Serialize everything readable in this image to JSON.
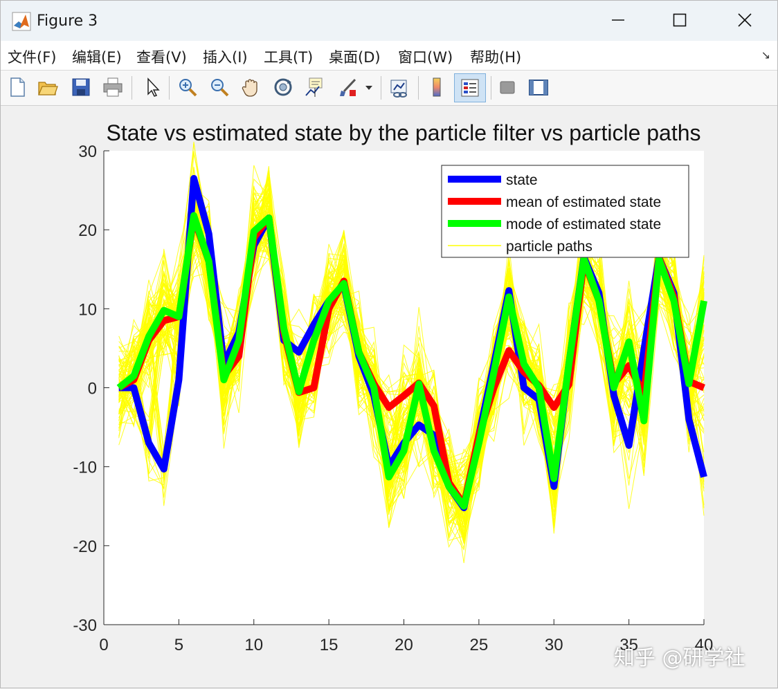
{
  "window": {
    "title": "Figure 3"
  },
  "menu": {
    "items": [
      "文件(F)",
      "编辑(E)",
      "查看(V)",
      "插入(I)",
      "工具(T)",
      "桌面(D)",
      "窗口(W)",
      "帮助(H)"
    ],
    "overflow_icon": "dock-arrow-icon"
  },
  "toolbar": {
    "icons": [
      "new-figure-icon",
      "open-file-icon",
      "save-icon",
      "print-icon",
      "pointer-icon",
      "zoom-in-icon",
      "zoom-out-icon",
      "pan-hand-icon",
      "rotate-3d-icon",
      "data-cursor-icon",
      "brush-icon",
      "link-plot-icon",
      "colorbar-icon",
      "legend-icon",
      "hide-plot-tools-icon",
      "show-plot-tools-icon"
    ]
  },
  "watermark": "知乎 @研学社",
  "colors": {
    "state": "#0000ff",
    "mean": "#ff0000",
    "mode": "#00ff00",
    "particles": "#ffff00"
  },
  "chart_data": {
    "type": "line",
    "title": "State vs estimated state by the particle filter vs particle paths",
    "xlim": [
      0,
      40
    ],
    "ylim": [
      -30,
      30
    ],
    "xticks": [
      0,
      5,
      10,
      15,
      20,
      25,
      30,
      35,
      40
    ],
    "yticks": [
      -30,
      -20,
      -10,
      0,
      10,
      20,
      30
    ],
    "legend_position": "top-right",
    "x": [
      1,
      2,
      3,
      4,
      5,
      6,
      7,
      8,
      9,
      10,
      11,
      12,
      13,
      14,
      15,
      16,
      17,
      18,
      19,
      20,
      21,
      22,
      23,
      24,
      25,
      26,
      27,
      28,
      29,
      30,
      31,
      32,
      33,
      34,
      35,
      36,
      37,
      38,
      39,
      40
    ],
    "series": [
      {
        "name": "state",
        "color": "#0000ff",
        "values": [
          0,
          0,
          -7,
          -10.3,
          1,
          26.5,
          19.5,
          3,
          7,
          18,
          21.5,
          6,
          4.5,
          8,
          11,
          13,
          4,
          -1,
          -10,
          -7,
          -4.7,
          -6,
          -12.5,
          -15.2,
          -6,
          3,
          12.3,
          0,
          -1.5,
          -12.5,
          3,
          16.5,
          12,
          -1,
          -7.3,
          4.8,
          16.5,
          12,
          -4,
          -11.3
        ]
      },
      {
        "name": "mean of estimated state",
        "color": "#ff0000",
        "values": [
          0,
          1,
          6,
          8.5,
          9,
          21.5,
          16,
          1.5,
          4,
          19,
          21.5,
          7,
          -0.6,
          0,
          10,
          13.5,
          4.5,
          0.5,
          -2.5,
          -1,
          0.6,
          -2.3,
          -12,
          -14.8,
          -6,
          0,
          4.7,
          2,
          0.3,
          -2.5,
          0.4,
          16,
          11,
          0.5,
          2.8,
          -0.8,
          16.5,
          11.5,
          0.8,
          0
        ]
      },
      {
        "name": "mode of estimated state",
        "color": "#00ff00",
        "values": [
          0,
          1.5,
          6.5,
          9.8,
          9,
          21.8,
          16,
          1,
          6,
          19.8,
          21.5,
          7.5,
          -0.5,
          6,
          11,
          13.2,
          4.5,
          0,
          -11.3,
          -8,
          0.5,
          -8,
          -12.5,
          -15,
          -7,
          2,
          11.5,
          3,
          0,
          -11.5,
          3,
          16.3,
          11,
          0,
          5.8,
          -4.2,
          16.3,
          11,
          0.5,
          11
        ]
      }
    ],
    "particles": {
      "name": "particle paths",
      "color": "#ffff00",
      "count": 100,
      "spread": 3.2
    }
  }
}
